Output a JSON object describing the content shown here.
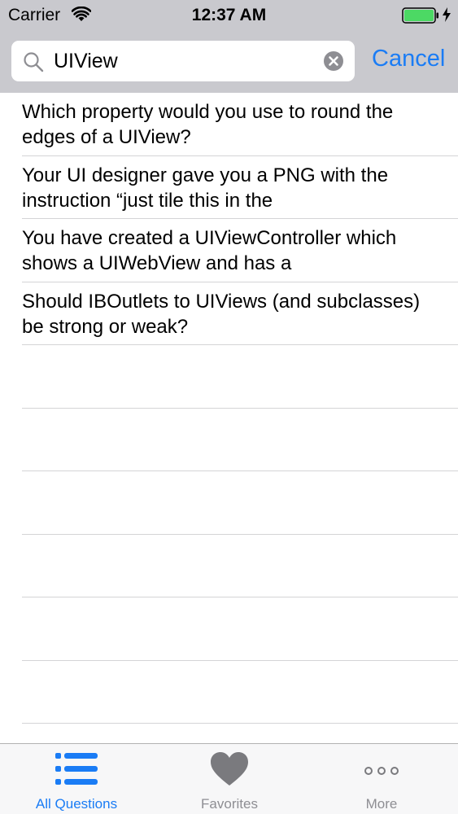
{
  "status_bar": {
    "carrier": "Carrier",
    "time": "12:37 AM",
    "icons": [
      "wifi-icon",
      "battery-icon",
      "charging-icon"
    ]
  },
  "search": {
    "value": "UIView",
    "icon": "search-icon",
    "clear_icon": "clear-icon",
    "cancel_label": "Cancel"
  },
  "results": [
    {
      "text": "Which property would you use to round the edges of a UIView?"
    },
    {
      "text": "Your UI designer gave you a PNG with the instruction “just tile this in the"
    },
    {
      "text": "You have created a UIViewController which shows a UIWebView and has a"
    },
    {
      "text": "Should IBOutlets to UIViews (and subclasses) be strong or weak?"
    }
  ],
  "tab_bar": {
    "tabs": [
      {
        "label": "All Questions",
        "icon": "list-icon",
        "active": true
      },
      {
        "label": "Favorites",
        "icon": "heart-icon",
        "active": false
      },
      {
        "label": "More",
        "icon": "more-icon",
        "active": false
      }
    ]
  },
  "colors": {
    "accent": "#1a7cf5",
    "header_bg": "#c9c9ce",
    "battery": "#4cd964",
    "inactive": "#8e8e93"
  }
}
